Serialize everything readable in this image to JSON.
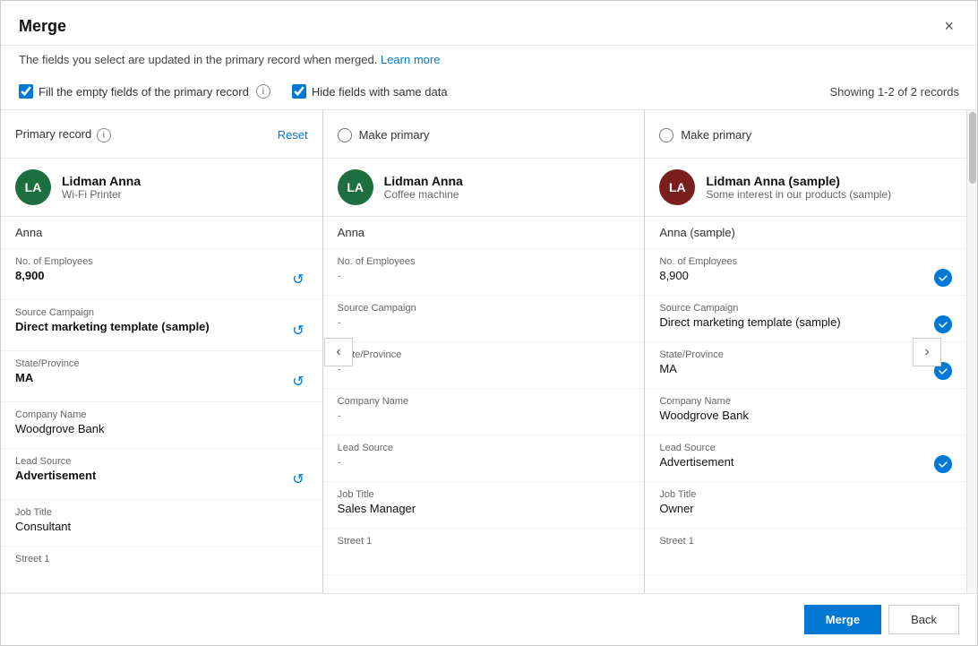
{
  "dialog": {
    "title": "Merge",
    "subtitle_text": "The fields you select are updated in the primary record when merged.",
    "subtitle_link": "Learn more",
    "close_label": "×"
  },
  "options": {
    "fill_empty_label": "Fill the empty fields of the primary record",
    "hide_same_label": "Hide fields with same data",
    "records_count": "Showing 1-2 of 2 records"
  },
  "columns": [
    {
      "id": "col1",
      "header_type": "primary",
      "header_label": "Primary record",
      "reset_label": "Reset",
      "avatar_initials": "LA",
      "avatar_color": "green",
      "record_name": "Lidman Anna",
      "record_sub": "Wi-Fi Printer",
      "simple_name": "Anna",
      "fields": [
        {
          "label": "No. of Employees",
          "value": "8,900",
          "bold": true,
          "has_action": true,
          "has_check": false,
          "empty": false
        },
        {
          "label": "Source Campaign",
          "value": "Direct marketing template (sample)",
          "bold": true,
          "has_action": true,
          "has_check": false,
          "empty": false
        },
        {
          "label": "State/Province",
          "value": "MA",
          "bold": true,
          "has_action": true,
          "has_check": false,
          "empty": false
        },
        {
          "label": "Company Name",
          "value": "Woodgrove Bank",
          "bold": false,
          "has_action": false,
          "has_check": false,
          "empty": false
        },
        {
          "label": "Lead Source",
          "value": "Advertisement",
          "bold": true,
          "has_action": true,
          "has_check": false,
          "empty": false
        },
        {
          "label": "Job Title",
          "value": "Consultant",
          "bold": false,
          "has_action": false,
          "has_check": false,
          "empty": false
        },
        {
          "label": "Street 1",
          "value": "",
          "bold": false,
          "has_action": false,
          "has_check": false,
          "empty": false
        }
      ]
    },
    {
      "id": "col2",
      "header_type": "make_primary",
      "header_label": "Make primary",
      "avatar_initials": "LA",
      "avatar_color": "green",
      "record_name": "Lidman Anna",
      "record_sub": "Coffee machine",
      "simple_name": "Anna",
      "fields": [
        {
          "label": "No. of Employees",
          "value": "-",
          "bold": false,
          "has_action": false,
          "has_check": false,
          "empty": true
        },
        {
          "label": "Source Campaign",
          "value": "-",
          "bold": false,
          "has_action": false,
          "has_check": false,
          "empty": true
        },
        {
          "label": "State/Province",
          "value": "-",
          "bold": false,
          "has_action": false,
          "has_check": false,
          "empty": true
        },
        {
          "label": "Company Name",
          "value": "-",
          "bold": false,
          "has_action": false,
          "has_check": false,
          "empty": true
        },
        {
          "label": "Lead Source",
          "value": "-",
          "bold": false,
          "has_action": false,
          "has_check": false,
          "empty": true
        },
        {
          "label": "Job Title",
          "value": "Sales Manager",
          "bold": false,
          "has_action": false,
          "has_check": false,
          "empty": false
        },
        {
          "label": "Street 1",
          "value": "",
          "bold": false,
          "has_action": false,
          "has_check": false,
          "empty": false
        }
      ]
    },
    {
      "id": "col3",
      "header_type": "make_primary",
      "header_label": "Make primary",
      "avatar_initials": "LA",
      "avatar_color": "dark-red",
      "record_name": "Lidman Anna (sample)",
      "record_sub": "Some interest in our products (sample)",
      "simple_name": "Anna (sample)",
      "fields": [
        {
          "label": "No. of Employees",
          "value": "8,900",
          "bold": false,
          "has_action": false,
          "has_check": true,
          "empty": false
        },
        {
          "label": "Source Campaign",
          "value": "Direct marketing template (sample)",
          "bold": false,
          "has_action": false,
          "has_check": true,
          "empty": false
        },
        {
          "label": "State/Province",
          "value": "MA",
          "bold": false,
          "has_action": false,
          "has_check": true,
          "empty": false
        },
        {
          "label": "Company Name",
          "value": "Woodgrove Bank",
          "bold": false,
          "has_action": false,
          "has_check": false,
          "empty": false
        },
        {
          "label": "Lead Source",
          "value": "Advertisement",
          "bold": false,
          "has_action": false,
          "has_check": true,
          "empty": false
        },
        {
          "label": "Job Title",
          "value": "Owner",
          "bold": false,
          "has_action": false,
          "has_check": false,
          "empty": false
        },
        {
          "label": "Street 1",
          "value": "",
          "bold": false,
          "has_action": false,
          "has_check": false,
          "empty": false
        }
      ]
    }
  ],
  "footer": {
    "merge_label": "Merge",
    "back_label": "Back"
  }
}
